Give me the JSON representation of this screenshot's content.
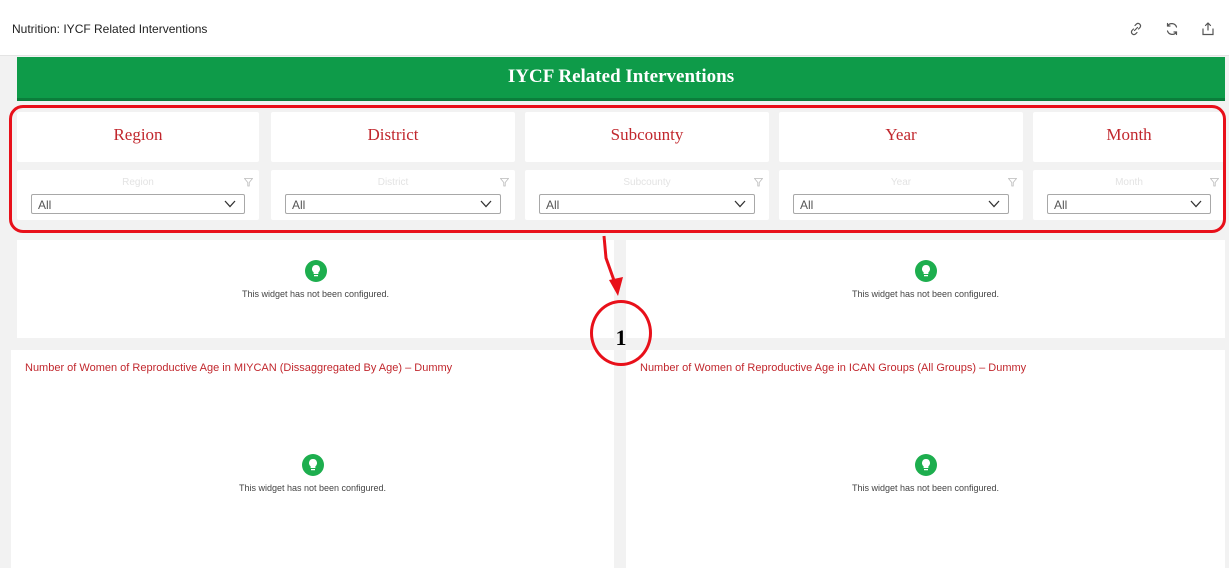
{
  "header": {
    "title": "Nutrition: IYCF Related Interventions",
    "icons": [
      "link-icon",
      "refresh-icon",
      "export-icon"
    ]
  },
  "banner": {
    "title": "IYCF Related Interventions"
  },
  "filters": [
    {
      "label": "Region",
      "value": "All"
    },
    {
      "label": "District",
      "value": "All"
    },
    {
      "label": "Subcounty",
      "value": "All"
    },
    {
      "label": "Year",
      "value": "All"
    },
    {
      "label": "Month",
      "value": "All"
    }
  ],
  "annotation": {
    "number": "1",
    "color": "#e8101a"
  },
  "widgets": [
    {
      "title": "",
      "message": "This widget has not been configured."
    },
    {
      "title": "",
      "message": "This widget has not been configured."
    },
    {
      "title": "Number of Women of Reproductive Age in MIYCAN (Dissaggregated By Age) – Dummy",
      "message": "This widget has not been configured."
    },
    {
      "title": "Number of Women of Reproductive Age in ICAN Groups (All Groups) – Dummy",
      "message": "This widget has not been configured."
    }
  ],
  "colors": {
    "banner": "#0e9b49",
    "accent": "#c1272d",
    "bulb": "#1dae4e"
  }
}
